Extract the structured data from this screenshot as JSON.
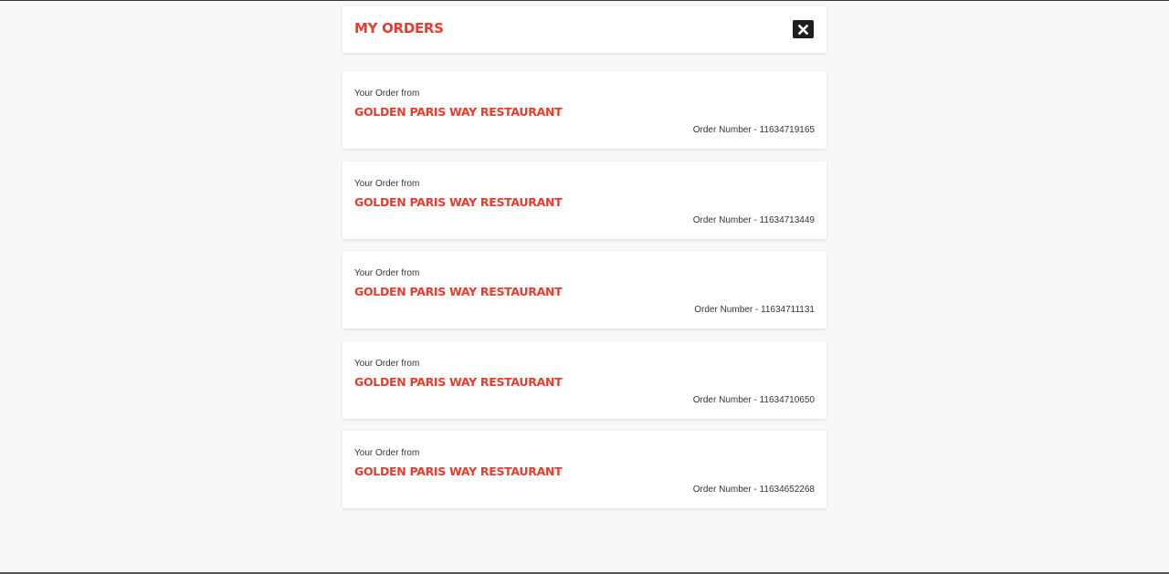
{
  "header": {
    "title": "MY ORDERS",
    "close_icon": "close-x-icon"
  },
  "orders": [
    {
      "from_label": "Your Order from",
      "restaurant": "GOLDEN PARIS WAY RESTAURANT",
      "order_number": "Order Number - 11634719165"
    },
    {
      "from_label": "Your Order from",
      "restaurant": "GOLDEN PARIS WAY RESTAURANT",
      "order_number": "Order Number - 11634713449"
    },
    {
      "from_label": "Your Order from",
      "restaurant": "GOLDEN PARIS WAY RESTAURANT",
      "order_number": "Order Number - 11634711131"
    },
    {
      "from_label": "Your Order from",
      "restaurant": "GOLDEN PARIS WAY RESTAURANT",
      "order_number": "Order Number - 11634710650"
    },
    {
      "from_label": "Your Order from",
      "restaurant": "GOLDEN PARIS WAY RESTAURANT",
      "order_number": "Order Number - 11634652268"
    }
  ],
  "colors": {
    "accent": "#f0392b",
    "background": "#f8f8f8",
    "card": "#ffffff"
  }
}
